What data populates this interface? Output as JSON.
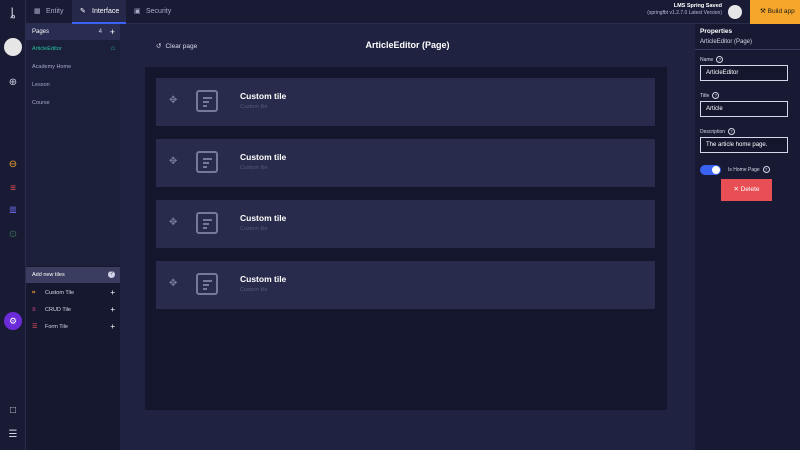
{
  "rail": {
    "logo_icon": "logo-icon",
    "icons": [
      "globe-icon",
      "puzzle-icon",
      "flow-icon",
      "list-icon",
      "users-icon",
      "gear-icon",
      "chat-icon",
      "menu-icon"
    ],
    "accent": "#6c2bd9"
  },
  "topbar": {
    "tabs": [
      {
        "label": "Entity",
        "icon": "entity-icon"
      },
      {
        "label": "Interface",
        "icon": "paint-brush-icon"
      },
      {
        "label": "Security",
        "icon": "lock-icon"
      }
    ],
    "project": {
      "name": "LMS Spring Saved",
      "version": "(springfbt v1.2.7.0",
      "version_note": "Latest Version)"
    },
    "build_label": "Build app",
    "build_color": "#f6a62b"
  },
  "left": {
    "pages_title": "Pages",
    "pages_count": "4",
    "pages": [
      {
        "label": "ArticleEditor",
        "active": true
      },
      {
        "label": "Academy Home",
        "active": false
      },
      {
        "label": "Lesson",
        "active": false
      },
      {
        "label": "Course",
        "active": false
      }
    ],
    "add_tiles_title": "Add new tiles",
    "tiles": [
      {
        "label": "Custom Tile",
        "icon": "custom-tile-icon",
        "color": "#f6a62b"
      },
      {
        "label": "CRUD Tile",
        "icon": "crud-tile-icon",
        "color": "#e84fa0"
      },
      {
        "label": "Form Tile",
        "icon": "form-tile-icon",
        "color": "#e84f55"
      }
    ]
  },
  "main": {
    "clear_label": "Clear page",
    "page_title": "ArticleEditor (Page)",
    "tiles": [
      {
        "title": "Custom tile",
        "subtitle": "Custom tile"
      },
      {
        "title": "Custom tile",
        "subtitle": "Custom tile"
      },
      {
        "title": "Custom tile",
        "subtitle": "Custom tile"
      },
      {
        "title": "Custom tile",
        "subtitle": "Custom tile"
      }
    ]
  },
  "properties": {
    "title": "Properties",
    "subtitle": "ArticleEditor (Page)",
    "name_label": "Name",
    "name_value": "ArticleEditor",
    "title_label": "Title",
    "title_value": "Article",
    "description_label": "Description",
    "description_value": "The article home page.",
    "home_toggle_label": "Is Home Page",
    "home_toggle_on": true,
    "delete_label": "Delete",
    "delete_color": "#e84f55"
  }
}
